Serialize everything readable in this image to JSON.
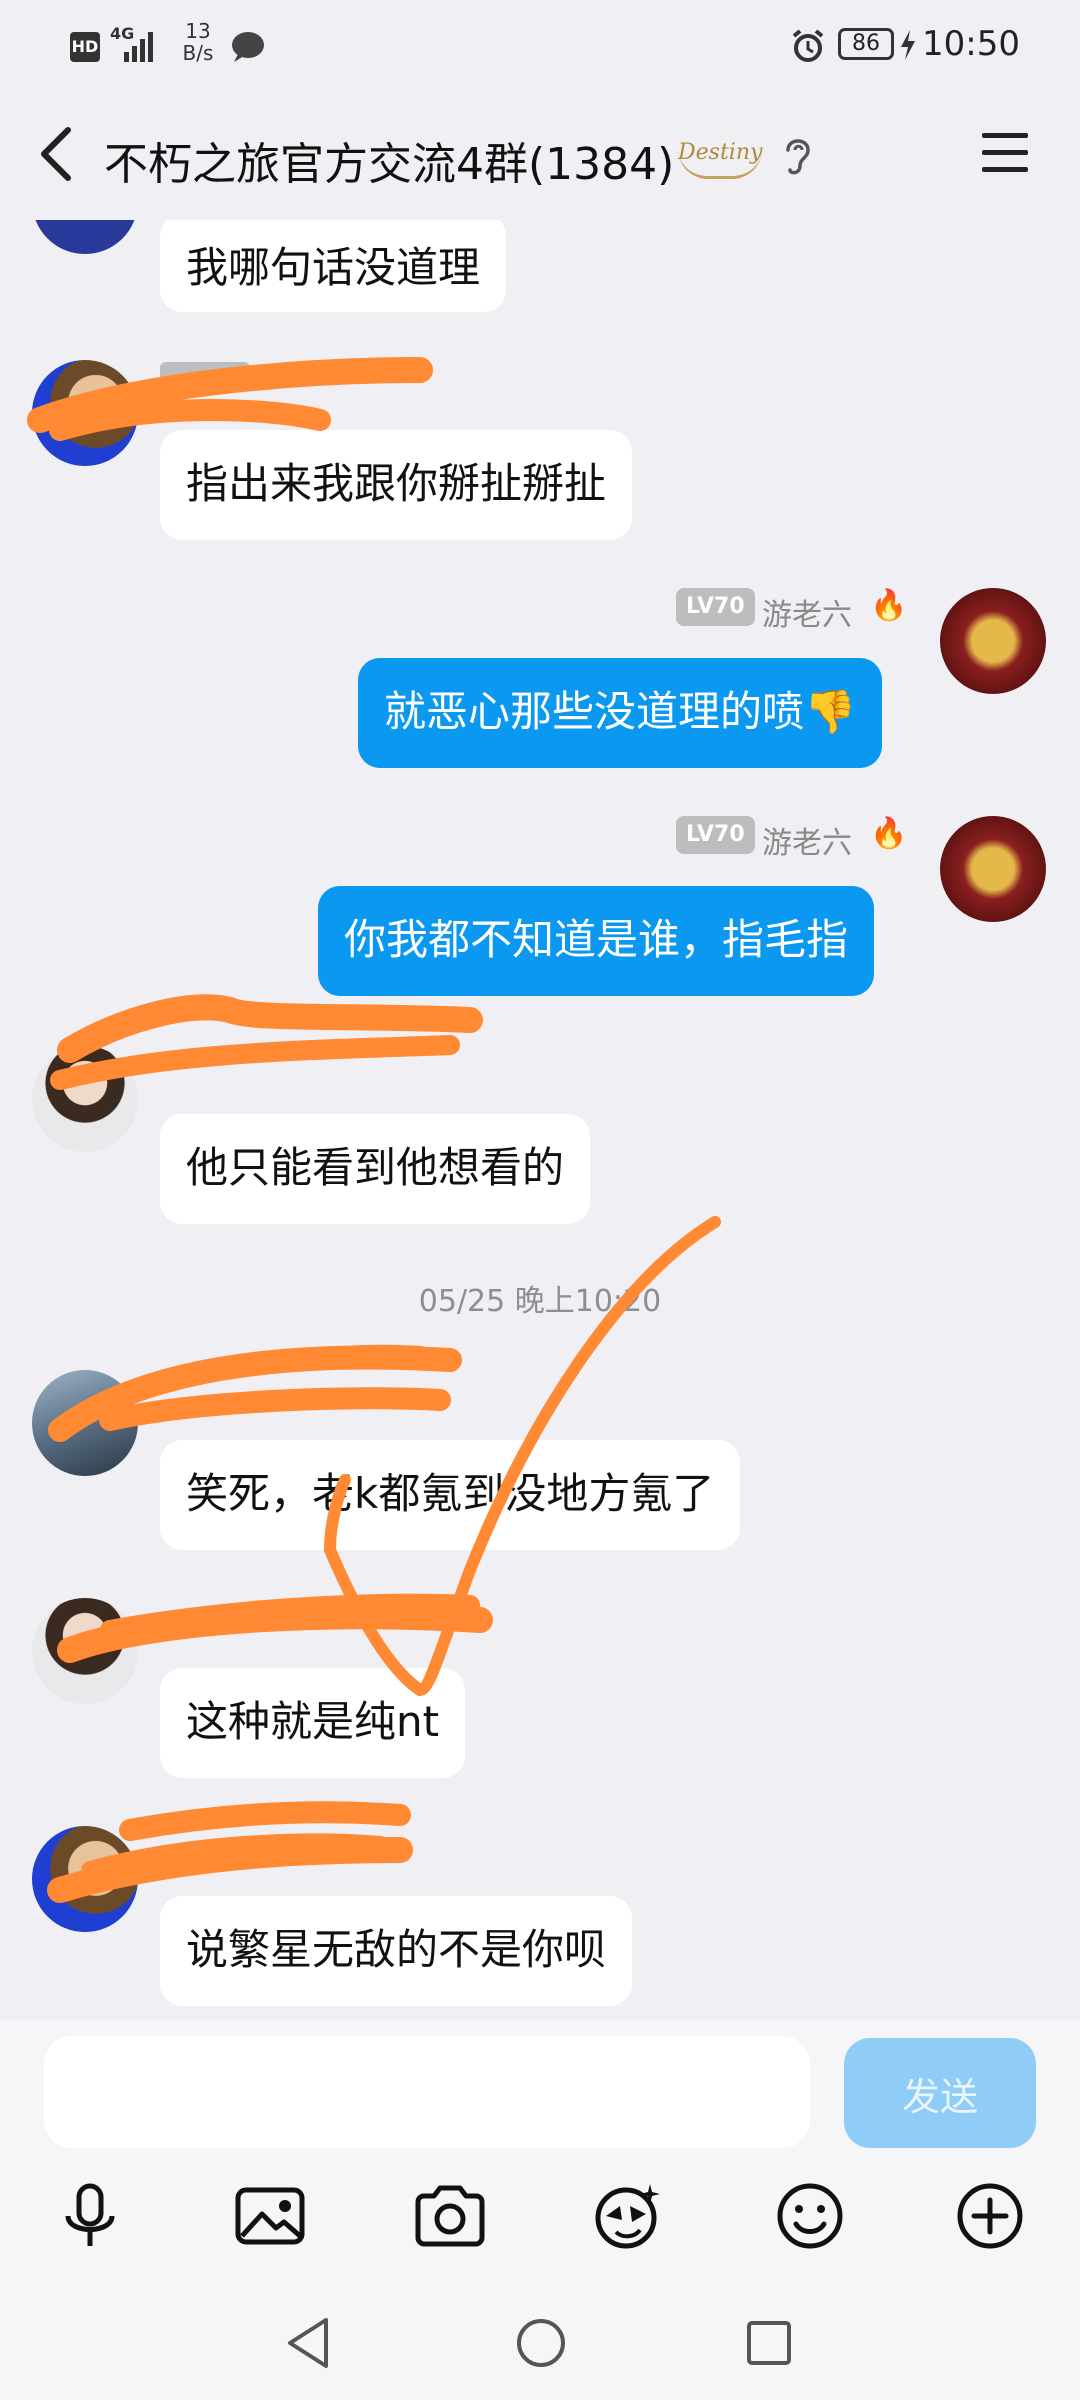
{
  "status_bar": {
    "network_hd": "HD",
    "network_4g": "4G",
    "speed_value": "13",
    "speed_unit": "B/s",
    "battery": "86",
    "time": "10:50"
  },
  "header": {
    "title": "不朽之旅官方交流4群(1384)",
    "logo_text": "Destiny"
  },
  "messages": [
    {
      "side": "in",
      "text": "我哪句话没道理"
    },
    {
      "side": "in",
      "text": "指出来我跟你掰扯掰扯"
    },
    {
      "side": "out",
      "level": "LV70",
      "sender": "游老六",
      "text": "就恶心那些没道理的喷👎"
    },
    {
      "side": "out",
      "level": "LV70",
      "sender": "游老六",
      "text": "你我都不知道是谁，指毛指"
    },
    {
      "side": "in",
      "text": "他只能看到他想看的"
    },
    {
      "side": "time",
      "text": "05/25 晚上10:20"
    },
    {
      "side": "in",
      "text": "笑死，老k都氪到没地方氪了"
    },
    {
      "side": "in",
      "text": "这种就是纯nt"
    },
    {
      "side": "in",
      "text": "说繁星无敌的不是你呗"
    }
  ],
  "composer": {
    "input_value": "",
    "send_label": "发送"
  },
  "toolbar": {
    "icons": [
      "microphone-icon",
      "image-icon",
      "camera-icon",
      "sticker-icon",
      "emoji-icon",
      "plus-icon"
    ]
  },
  "navbar": {
    "icons": [
      "back-triangle-icon",
      "home-circle-icon",
      "recents-square-icon"
    ]
  },
  "colors": {
    "outgoing_bubble": "#0a98f0",
    "incoming_bubble": "#ffffff",
    "background": "#efeff4",
    "send_button": "#8fccf6",
    "scribble": "#ff8a33"
  }
}
